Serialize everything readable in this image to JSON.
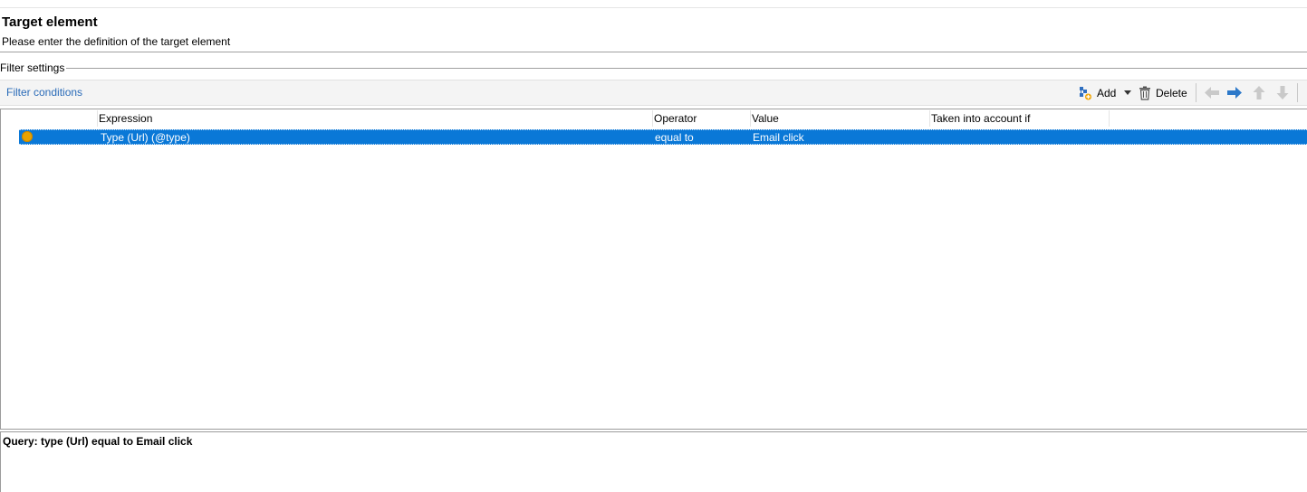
{
  "header": {
    "title": "Target element",
    "subtitle": "Please enter the definition of the target element"
  },
  "filter_settings": {
    "legend": "Filter settings",
    "toolbar": {
      "label": "Filter conditions",
      "add_label": "Add",
      "delete_label": "Delete"
    },
    "grid": {
      "columns": [
        "Expression",
        "Operator",
        "Value",
        "Taken into account if"
      ],
      "rows": [
        {
          "expression": "Type (Url) (@type)",
          "operator": "equal to",
          "value": "Email click",
          "taken_into_account_if": "",
          "status_color": "#e8a200"
        }
      ],
      "selection_color": "#0a78d7"
    }
  },
  "query": {
    "text": "Query: type (Url) equal to Email click"
  }
}
